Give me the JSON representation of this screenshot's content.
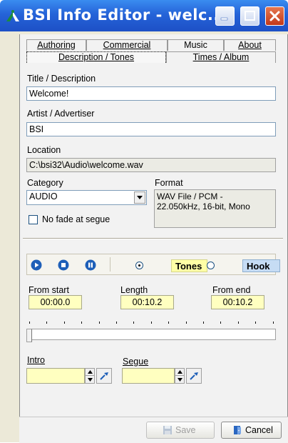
{
  "window": {
    "title": "BSI Info Editor - welc...",
    "icon": "bsi-app-icon",
    "controls": [
      "minimize-icon",
      "maximize-icon",
      "close-icon"
    ]
  },
  "tabs": {
    "row1": [
      "Authoring",
      "Commercial",
      "Music",
      "About"
    ],
    "row2": [
      "Description / Tones",
      "Times / Album"
    ],
    "active": "Description / Tones"
  },
  "form": {
    "title_label": "Title / Description",
    "title_value": "Welcome!",
    "artist_label": "Artist / Advertiser",
    "artist_value": "BSI",
    "location_label": "Location",
    "location_value": "C:\\bsi32\\Audio\\welcome.wav",
    "category_label": "Category",
    "category_value": "AUDIO",
    "format_label": "Format",
    "format_line1": "WAV File / PCM -",
    "format_line2": "22.050kHz, 16-bit, Mono",
    "nofade_label": "No fade at segue",
    "nofade_checked": false
  },
  "transport": {
    "buttons": [
      "play-icon",
      "stop-icon",
      "pause-icon"
    ],
    "tones_label": "Tones",
    "hook_label": "Hook",
    "selected_mode": "Tones"
  },
  "times": {
    "from_start_label": "From start",
    "from_start_value": "00:00.0",
    "length_label": "Length",
    "length_value": "00:10.2",
    "from_end_label": "From end",
    "from_end_value": "00:10.2",
    "slider_position": 0
  },
  "markers": {
    "intro_label": "Intro",
    "intro_value": "",
    "segue_label": "Segue",
    "segue_value": ""
  },
  "buttons": {
    "save_label": "Save",
    "cancel_label": "Cancel"
  },
  "colors": {
    "titlebar": "#2563d8",
    "time_field_bg": "#ffffc0",
    "tones_bg": "#ffffa6",
    "hook_bg": "#c6dcf4",
    "transport_blue": "#1e5fb8"
  }
}
